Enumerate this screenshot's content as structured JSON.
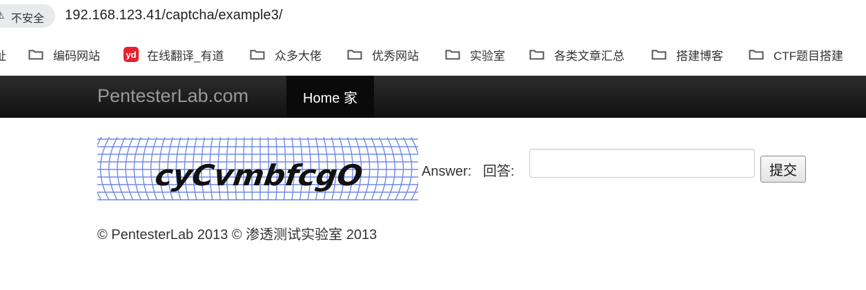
{
  "browser": {
    "security_label": "不安全",
    "url": "192.168.123.41/captcha/example3/"
  },
  "bookmarks": [
    {
      "label": "编码网站",
      "icon": "folder-icon"
    },
    {
      "label": "在线翻译_有道",
      "icon": "youdao-icon",
      "icon_text": "yd"
    },
    {
      "label": "众多大佬",
      "icon": "folder-icon"
    },
    {
      "label": "优秀网站",
      "icon": "folder-icon"
    },
    {
      "label": "实验室",
      "icon": "folder-icon"
    },
    {
      "label": "各类文章汇总",
      "icon": "folder-icon"
    },
    {
      "label": "搭建博客",
      "icon": "folder-icon"
    },
    {
      "label": "CTF题目搭建",
      "icon": "folder-icon"
    }
  ],
  "navbar": {
    "brand": "PentesterLab.com",
    "items": [
      {
        "label": "Home 家",
        "active": true
      }
    ]
  },
  "form": {
    "captcha_text": "cyCvmbfcgO",
    "answer_label": "Answer:   回答:",
    "answer_value": "",
    "submit_label": "提交"
  },
  "footer": {
    "text": "© PentesterLab 2013 © 渗透测试实验室 2013"
  },
  "colors": {
    "navbar": "#1b1b1b",
    "captcha_grid": "#6f88e8",
    "youdao_brand": "#e8212f"
  }
}
